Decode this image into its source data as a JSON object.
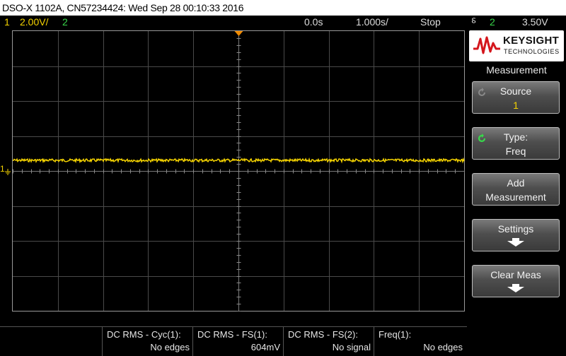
{
  "title": "DSO-X 1102A, CN57234424: Wed Sep 28 00:10:33 2016",
  "status": {
    "ch1_num": "1",
    "ch1_scale": "2.00V/",
    "ch2_num": "2",
    "delay": "0.0s",
    "timebase": "1.000s/",
    "run_state": "Stop",
    "trigger_symbol": "⸹",
    "trigger_source": "2",
    "trigger_level": "3.50V"
  },
  "colors": {
    "ch1": "#f5d300",
    "ch2": "#38d64a",
    "trigger_marker": "#f08a00"
  },
  "channel_marker": {
    "label": "1",
    "icon": "ground-icon"
  },
  "logo": {
    "brand": "KEYSIGHT",
    "sub": "TECHNOLOGIES"
  },
  "menu": {
    "title": "Measurement",
    "softkeys": [
      {
        "label1": "Source",
        "label2": "1",
        "icon": "knob-icon"
      },
      {
        "label1": "Type:",
        "label2": "Freq",
        "icon": "knob-icon"
      },
      {
        "label1": "Add",
        "label2": "Measurement"
      },
      {
        "label1": "Settings",
        "icon": "arrow-down-icon"
      },
      {
        "label1": "Clear Meas",
        "icon": "arrow-down-icon"
      }
    ]
  },
  "measurements": [
    {
      "name": "DC RMS - Cyc(1):",
      "value": "No edges"
    },
    {
      "name": "DC RMS - FS(1):",
      "value": "604mV"
    },
    {
      "name": "DC RMS - FS(2):",
      "value": "No signal"
    },
    {
      "name": "Freq(1):",
      "value": "No edges"
    }
  ]
}
